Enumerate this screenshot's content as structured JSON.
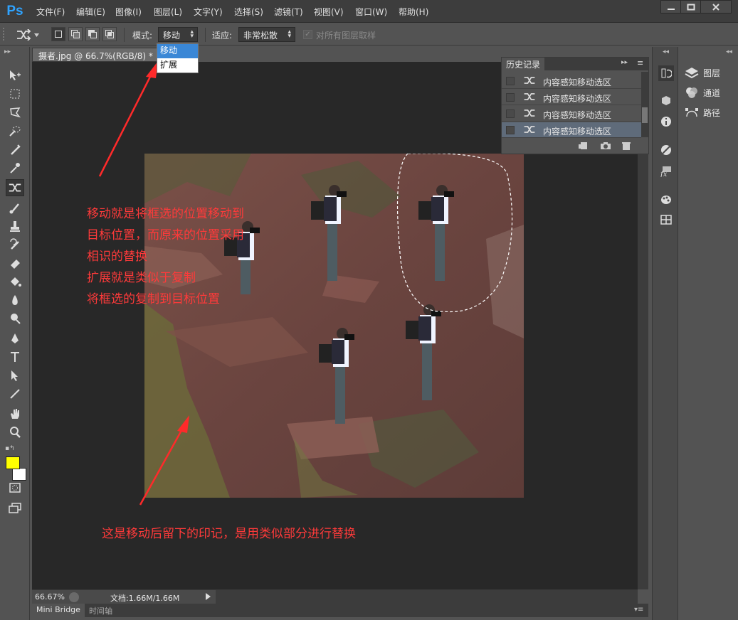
{
  "app": {
    "logo": "Ps"
  },
  "menu": [
    "文件(F)",
    "编辑(E)",
    "图像(I)",
    "图层(L)",
    "文字(Y)",
    "选择(S)",
    "滤镜(T)",
    "视图(V)",
    "窗口(W)",
    "帮助(H)"
  ],
  "options": {
    "mode_label": "模式:",
    "mode_value": "移动",
    "adapt_label": "适应:",
    "adapt_value": "非常松散",
    "sample_all_layers": "对所有图层取样"
  },
  "dropdown": {
    "options": [
      "移动",
      "扩展"
    ],
    "selected": "移动"
  },
  "document": {
    "tab_title": "摄者.jpg @ 66.7%(RGB/8) *",
    "close": "×"
  },
  "history": {
    "title": "历史记录",
    "items": [
      "内容感知移动选区",
      "内容感知移动选区",
      "内容感知移动选区",
      "内容感知移动选区"
    ],
    "selected_index": 3
  },
  "annotations": {
    "top": [
      "移动就是将框选的位置移动到",
      "目标位置，而原来的位置采用",
      "相识的替换",
      "扩展就是类似于复制",
      "将框选的复制到目标位置"
    ],
    "bottom": "这是移动后留下的印记，是用类似部分进行替换"
  },
  "status": {
    "zoom": "66.67%",
    "doc": "文档:1.66M/1.66M"
  },
  "bottom_tabs": [
    "Mini Bridge",
    "时间轴"
  ],
  "right_panels": [
    "图层",
    "通道",
    "路径"
  ],
  "colors": {
    "foreground": "#ffff00",
    "background": "#ffffff",
    "accent": "#2fa3ff",
    "annotation": "#ff3a3a",
    "arrow": "#ff2a2a"
  },
  "icons": {
    "tools": [
      "move-icon",
      "marquee-icon",
      "lasso-icon",
      "quick-select-icon",
      "crop-icon",
      "eyedropper-icon",
      "content-aware-move-icon",
      "brush-icon",
      "clone-stamp-icon",
      "history-brush-icon",
      "eraser-icon",
      "paint-bucket-icon",
      "blur-icon",
      "dodge-icon",
      "pen-icon",
      "type-icon",
      "path-select-icon",
      "line-icon",
      "hand-icon",
      "zoom-icon"
    ],
    "history_actions": [
      "new-document-icon",
      "snapshot-icon",
      "trash-icon"
    ]
  }
}
